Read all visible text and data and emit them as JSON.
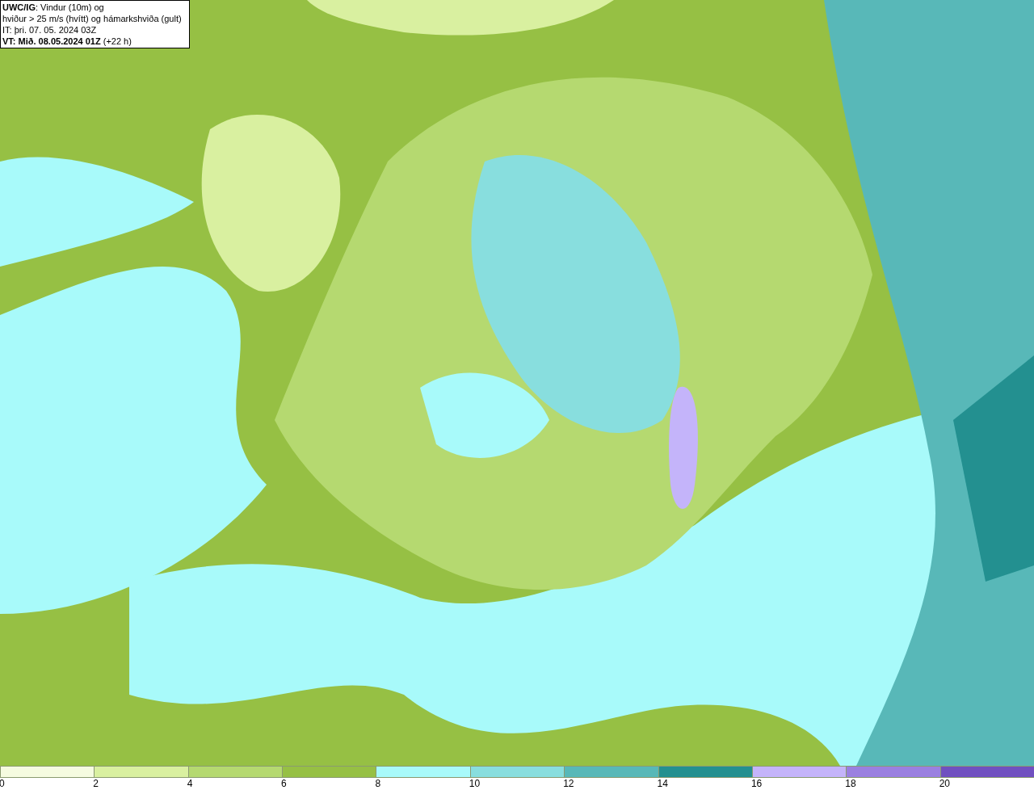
{
  "info_box": {
    "lines": [
      "**UWC/IG**: Vindur (10m) og",
      "hviður > 25 m/s (hvítt) og hámarkshviða (gult)",
      "IT: þri. 07. 05. 2024 03Z",
      "**VT: Mið. 08.05.2024 01Z** (+22 h)"
    ]
  },
  "legend": {
    "bins": [
      {
        "color": "#f5fbe0"
      },
      {
        "color": "#d9f0a0"
      },
      {
        "color": "#b5d970"
      },
      {
        "color": "#96c044"
      },
      {
        "color": "#a8fafa"
      },
      {
        "color": "#88dede"
      },
      {
        "color": "#58b8b8"
      },
      {
        "color": "#239090"
      },
      {
        "color": "#c4b4fa"
      },
      {
        "color": "#9a80e0"
      },
      {
        "color": "#7050c0"
      }
    ],
    "labels": [
      "0",
      "2",
      "4",
      "6",
      "8",
      "10",
      "12",
      "14",
      "16",
      "18",
      "20"
    ]
  }
}
